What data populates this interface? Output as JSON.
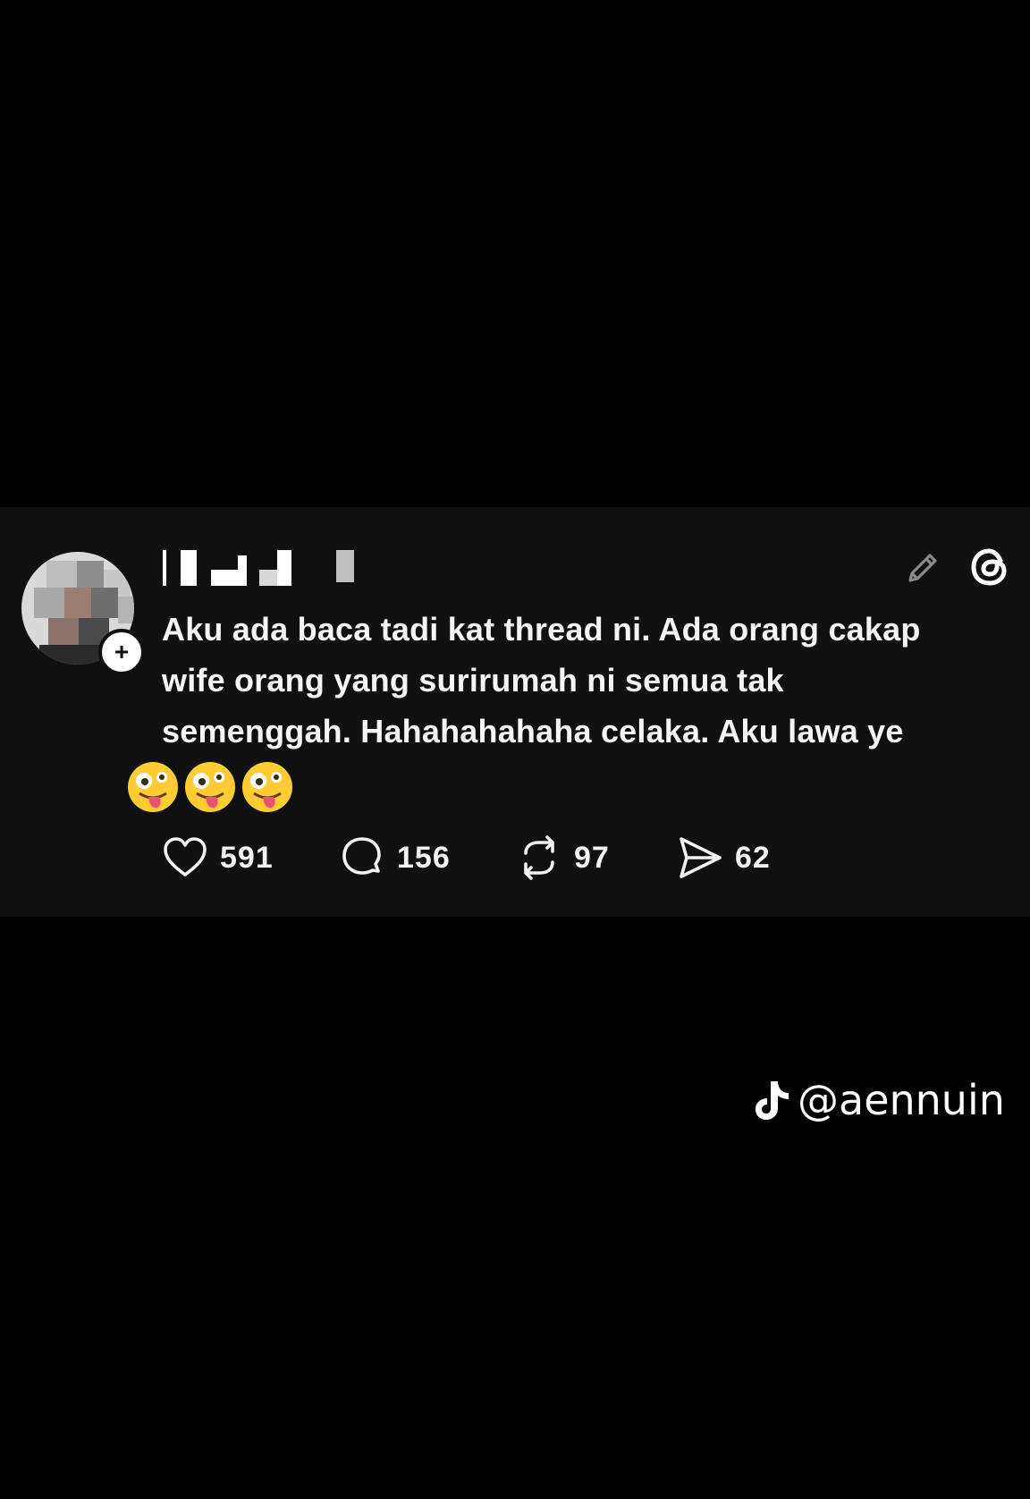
{
  "post": {
    "text": "Aku ada baca tadi kat thread ni. Ada orang cakap\nwife orang yang surirumah ni semua tak\nsemenggah. Hahahahahaha celaka. Aku lawa ye",
    "emojis": [
      "zany-face-emoji",
      "zany-face-emoji",
      "zany-face-emoji"
    ],
    "follow_badge": "+"
  },
  "actions": {
    "likes": "591",
    "replies": "156",
    "reposts": "97",
    "shares": "62"
  },
  "icons": {
    "like": "heart-icon",
    "reply": "speech-bubble-icon",
    "repost": "repost-arrows-icon",
    "share": "paper-plane-icon",
    "edit": "pencil-icon",
    "brand": "threads-logo-icon"
  },
  "watermark": {
    "handle": "@aennuin",
    "platform_icon": "tiktok-logo-icon"
  },
  "colors": {
    "background": "#000000",
    "card": "#101010",
    "text": "#f5f5f5",
    "muted_icon": "#8a8a8a"
  }
}
